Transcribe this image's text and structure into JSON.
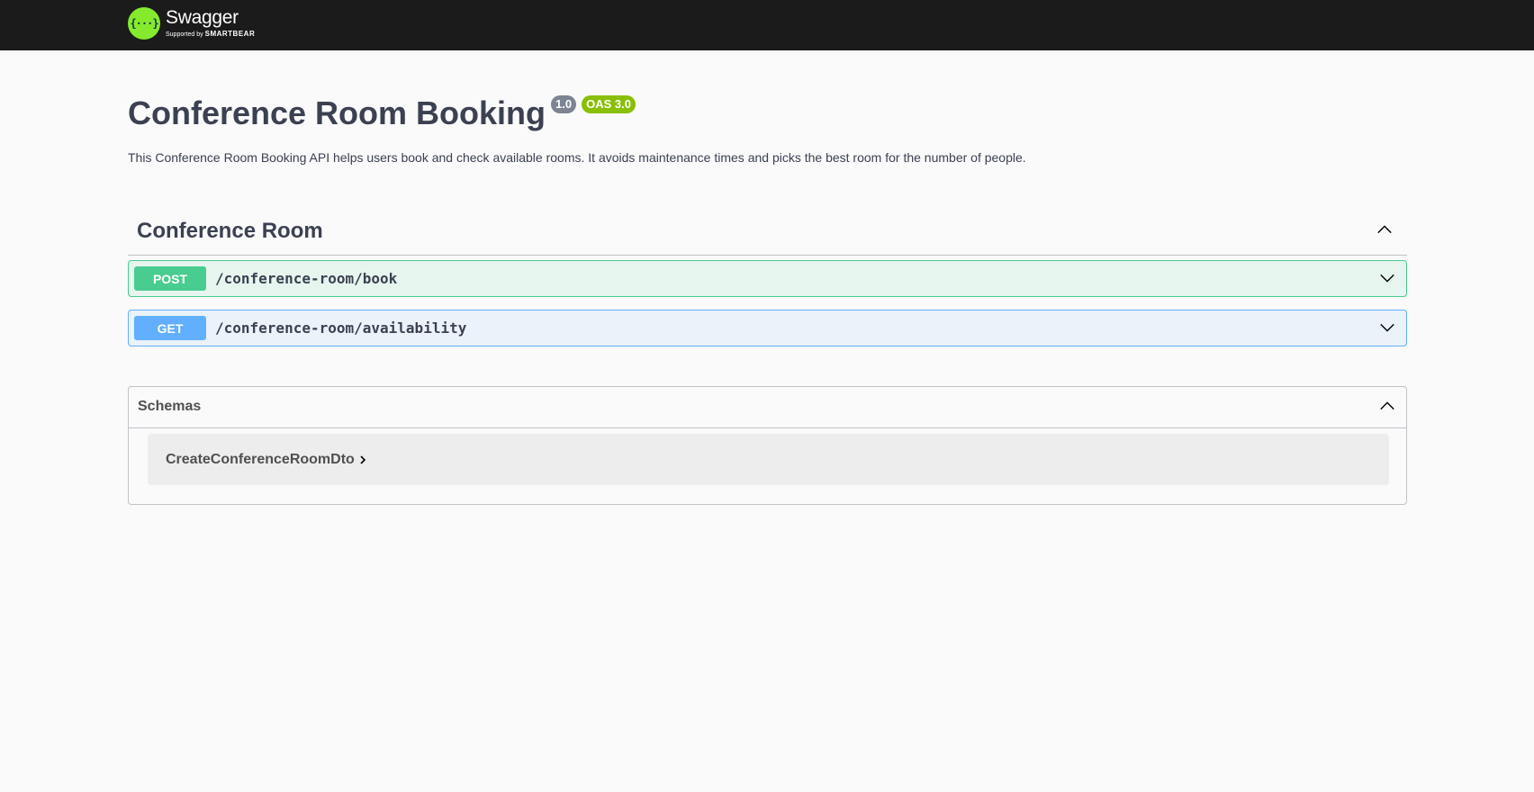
{
  "header": {
    "logo_name": "Swagger",
    "logo_sub_prefix": "Supported by",
    "logo_sub_brand": "SMARTBEAR",
    "logo_mark": "{···}"
  },
  "info": {
    "title": "Conference Room Booking",
    "version": "1.0",
    "oas": "OAS 3.0",
    "description": "This Conference Room Booking API helps users book and check available rooms. It avoids maintenance times and picks the best room for the number of people."
  },
  "tag": {
    "name": "Conference Room",
    "expanded_icon": "chevron-up-icon"
  },
  "operations": [
    {
      "method": "POST",
      "path": "/conference-room/book",
      "color": "#49cc90",
      "icon": "chevron-down-icon"
    },
    {
      "method": "GET",
      "path": "/conference-room/availability",
      "color": "#61affe",
      "icon": "chevron-down-icon"
    }
  ],
  "schemas": {
    "title": "Schemas",
    "expanded_icon": "chevron-up-icon",
    "models": [
      {
        "name": "CreateConferenceRoomDto",
        "icon": "chevron-right-icon"
      }
    ]
  },
  "colors": {
    "topbar": "#1b1b1b",
    "logo_green": "#85ea2d",
    "text": "#3b4151",
    "version_badge": "#7d8492",
    "oas_badge": "#89bf04"
  }
}
